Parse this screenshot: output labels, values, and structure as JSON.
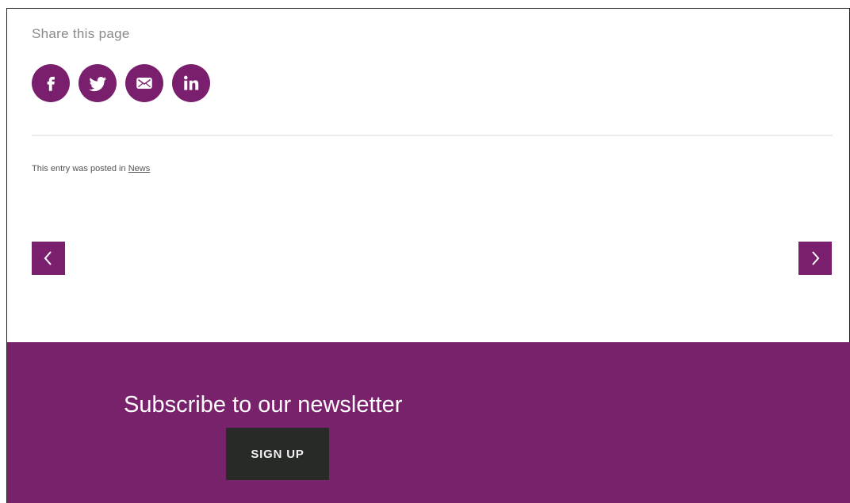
{
  "colors": {
    "accent": "#7a1f6e",
    "footer_bg": "#78226c",
    "button_dark": "#272a27"
  },
  "share": {
    "title": "Share this page",
    "icons": [
      {
        "name": "facebook-icon"
      },
      {
        "name": "twitter-icon"
      },
      {
        "name": "email-icon"
      },
      {
        "name": "linkedin-icon"
      }
    ]
  },
  "entry": {
    "posted_prefix": "This entry was posted in",
    "category": "News"
  },
  "pager": {
    "prev_icon": "chevron-left-icon",
    "next_icon": "chevron-right-icon"
  },
  "footer": {
    "title": "Subscribe to our newsletter",
    "signup_label": "SIGN UP"
  }
}
